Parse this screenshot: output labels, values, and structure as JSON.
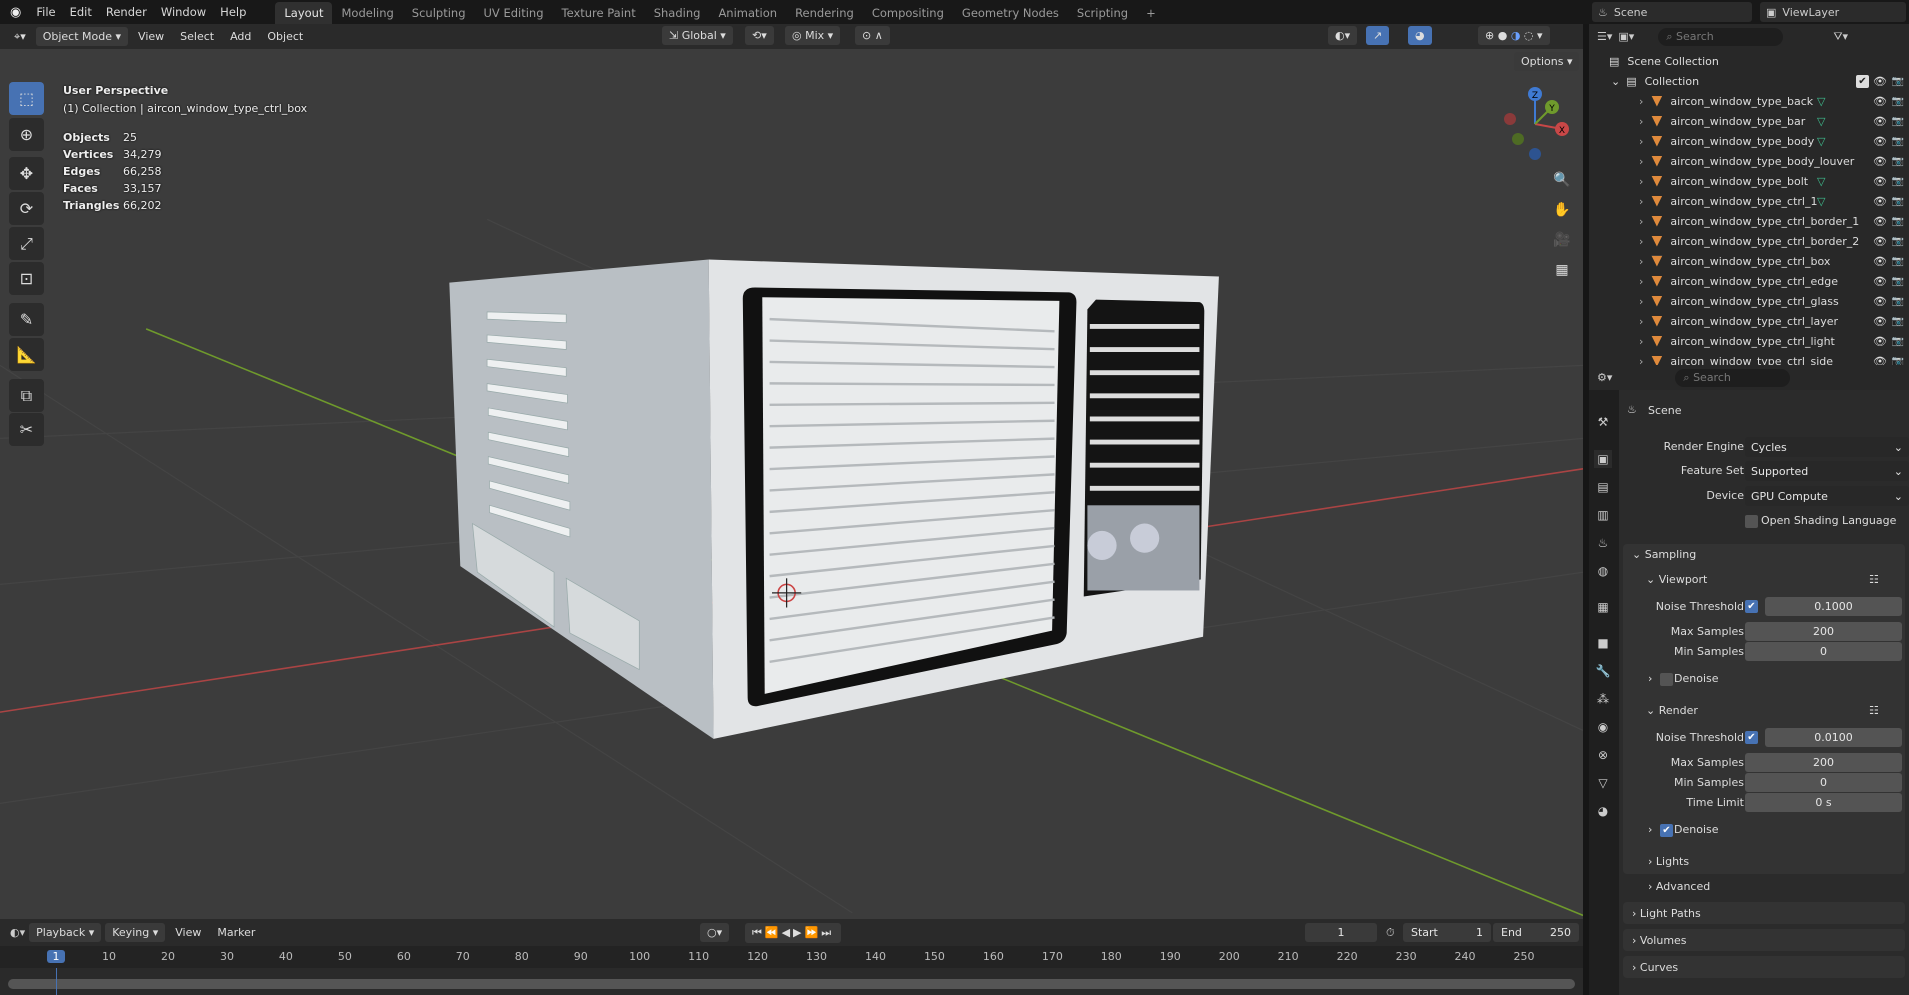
{
  "topbar": {
    "menus": [
      "File",
      "Edit",
      "Render",
      "Window",
      "Help"
    ],
    "workspaces": [
      "Layout",
      "Modeling",
      "Sculpting",
      "UV Editing",
      "Texture Paint",
      "Shading",
      "Animation",
      "Rendering",
      "Compositing",
      "Geometry Nodes",
      "Scripting"
    ],
    "active_workspace": "Layout",
    "add_tab": "+",
    "scene": "Scene",
    "view_layer": "ViewLayer"
  },
  "viewport_header": {
    "mode": "Object Mode",
    "menus": [
      "View",
      "Select",
      "Add",
      "Object"
    ],
    "orientation": "Global",
    "pivot": "Mix",
    "options": "Options"
  },
  "overlay": {
    "perspective": "User Perspective",
    "collection": "(1) Collection | aircon_window_type_ctrl_box",
    "stats": [
      {
        "label": "Objects",
        "value": "25"
      },
      {
        "label": "Vertices",
        "value": "34,279"
      },
      {
        "label": "Edges",
        "value": "66,258"
      },
      {
        "label": "Faces",
        "value": "33,157"
      },
      {
        "label": "Triangles",
        "value": "66,202"
      }
    ]
  },
  "gizmo": {
    "x": "X",
    "y": "Y",
    "z": "Z"
  },
  "outliner": {
    "search_placeholder": "Search",
    "scene_collection": "Scene Collection",
    "collection": "Collection",
    "items": [
      {
        "name": "aircon_window_type_back",
        "mesh_icon": true
      },
      {
        "name": "aircon_window_type_bar",
        "mesh_icon": true
      },
      {
        "name": "aircon_window_type_body",
        "mesh_icon": true
      },
      {
        "name": "aircon_window_type_body_louver",
        "mesh_icon": false
      },
      {
        "name": "aircon_window_type_bolt",
        "mesh_icon": true
      },
      {
        "name": "aircon_window_type_ctrl_1",
        "mesh_icon": true
      },
      {
        "name": "aircon_window_type_ctrl_border_1",
        "mesh_icon": false
      },
      {
        "name": "aircon_window_type_ctrl_border_2",
        "mesh_icon": false
      },
      {
        "name": "aircon_window_type_ctrl_box",
        "mesh_icon": false,
        "active": true
      },
      {
        "name": "aircon_window_type_ctrl_edge",
        "mesh_icon": false
      },
      {
        "name": "aircon_window_type_ctrl_glass",
        "mesh_icon": false
      },
      {
        "name": "aircon_window_type_ctrl_layer",
        "mesh_icon": false
      },
      {
        "name": "aircon_window_type_ctrl_light",
        "mesh_icon": false
      },
      {
        "name": "aircon_window_type_ctrl_side",
        "mesh_icon": false
      }
    ]
  },
  "properties": {
    "search_placeholder": "Search",
    "context": "Scene",
    "render_engine": {
      "label": "Render Engine",
      "value": "Cycles"
    },
    "feature_set": {
      "label": "Feature Set",
      "value": "Supported"
    },
    "device": {
      "label": "Device",
      "value": "GPU Compute"
    },
    "osl": {
      "label": "Open Shading Language",
      "checked": false
    },
    "sampling": {
      "title": "Sampling",
      "viewport": {
        "title": "Viewport",
        "noise_label": "Noise Threshold",
        "noise": "0.1000",
        "noise_enabled": true,
        "max_label": "Max Samples",
        "max": "200",
        "min_label": "Min Samples",
        "min": "0",
        "denoise": "Denoise",
        "denoise_checked": false
      },
      "render": {
        "title": "Render",
        "noise_label": "Noise Threshold",
        "noise": "0.0100",
        "noise_enabled": true,
        "max_label": "Max Samples",
        "max": "200",
        "min_label": "Min Samples",
        "min": "0",
        "time_label": "Time Limit",
        "time": "0 s",
        "denoise": "Denoise",
        "denoise_checked": true
      },
      "lights": "Lights",
      "advanced": "Advanced"
    },
    "light_paths": "Light Paths",
    "volumes": "Volumes",
    "curves": "Curves"
  },
  "timeline": {
    "menus": [
      "Playback",
      "Keying",
      "View",
      "Marker"
    ],
    "current_frame": "1",
    "start_label": "Start",
    "start": "1",
    "end_label": "End",
    "end": "250",
    "ticks": [
      1,
      10,
      20,
      30,
      40,
      50,
      60,
      70,
      80,
      90,
      100,
      110,
      120,
      130,
      140,
      150,
      160,
      170,
      180,
      190,
      200,
      210,
      220,
      230,
      240,
      250
    ]
  },
  "colors": {
    "accent": "#4772b3",
    "object_orange": "#e08a3c",
    "mesh_green": "#3fbf8f",
    "x_axis": "#c84747",
    "y_axis": "#6f9a2c",
    "z_axis": "#3f7ad3"
  }
}
